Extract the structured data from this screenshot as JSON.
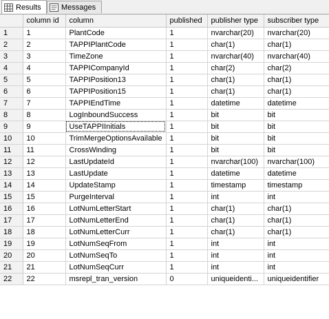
{
  "tabs": [
    {
      "label": "Results",
      "icon": "grid-icon",
      "active": true
    },
    {
      "label": "Messages",
      "icon": "messages-icon",
      "active": false
    }
  ],
  "grid": {
    "columns": [
      "column id",
      "column",
      "published",
      "publisher type",
      "subscriber type"
    ],
    "selected_cell": {
      "row": 9,
      "column": "column"
    },
    "rows": [
      {
        "num": "1",
        "cells": [
          "1",
          "PlantCode",
          "1",
          "nvarchar(20)",
          "nvarchar(20)"
        ]
      },
      {
        "num": "2",
        "cells": [
          "2",
          "TAPPIPlantCode",
          "1",
          "char(1)",
          "char(1)"
        ]
      },
      {
        "num": "3",
        "cells": [
          "3",
          "TimeZone",
          "1",
          "nvarchar(40)",
          "nvarchar(40)"
        ]
      },
      {
        "num": "4",
        "cells": [
          "4",
          "TAPPICompanyId",
          "1",
          "char(2)",
          "char(2)"
        ]
      },
      {
        "num": "5",
        "cells": [
          "5",
          "TAPPIPosition13",
          "1",
          "char(1)",
          "char(1)"
        ]
      },
      {
        "num": "6",
        "cells": [
          "6",
          "TAPPIPosition15",
          "1",
          "char(1)",
          "char(1)"
        ]
      },
      {
        "num": "7",
        "cells": [
          "7",
          "TAPPIEndTime",
          "1",
          "datetime",
          "datetime"
        ]
      },
      {
        "num": "8",
        "cells": [
          "8",
          "LogInboundSuccess",
          "1",
          "bit",
          "bit"
        ]
      },
      {
        "num": "9",
        "cells": [
          "9",
          "UseTAPPIInitials",
          "1",
          "bit",
          "bit"
        ]
      },
      {
        "num": "10",
        "cells": [
          "10",
          "TrimMergeOptionsAvailable",
          "1",
          "bit",
          "bit"
        ]
      },
      {
        "num": "11",
        "cells": [
          "11",
          "CrossWinding",
          "1",
          "bit",
          "bit"
        ]
      },
      {
        "num": "12",
        "cells": [
          "12",
          "LastUpdateId",
          "1",
          "nvarchar(100)",
          "nvarchar(100)"
        ]
      },
      {
        "num": "13",
        "cells": [
          "13",
          "LastUpdate",
          "1",
          "datetime",
          "datetime"
        ]
      },
      {
        "num": "14",
        "cells": [
          "14",
          "UpdateStamp",
          "1",
          "timestamp",
          "timestamp"
        ]
      },
      {
        "num": "15",
        "cells": [
          "15",
          "PurgeInterval",
          "1",
          "int",
          "int"
        ]
      },
      {
        "num": "16",
        "cells": [
          "16",
          "LotNumLetterStart",
          "1",
          "char(1)",
          "char(1)"
        ]
      },
      {
        "num": "17",
        "cells": [
          "17",
          "LotNumLetterEnd",
          "1",
          "char(1)",
          "char(1)"
        ]
      },
      {
        "num": "18",
        "cells": [
          "18",
          "LotNumLetterCurr",
          "1",
          "char(1)",
          "char(1)"
        ]
      },
      {
        "num": "19",
        "cells": [
          "19",
          "LotNumSeqFrom",
          "1",
          "int",
          "int"
        ]
      },
      {
        "num": "20",
        "cells": [
          "20",
          "LotNumSeqTo",
          "1",
          "int",
          "int"
        ]
      },
      {
        "num": "21",
        "cells": [
          "21",
          "LotNumSeqCurr",
          "1",
          "int",
          "int"
        ]
      },
      {
        "num": "22",
        "cells": [
          "22",
          "msrepl_tran_version",
          "0",
          "uniqueidenti...",
          "uniqueidentifier"
        ]
      }
    ]
  }
}
